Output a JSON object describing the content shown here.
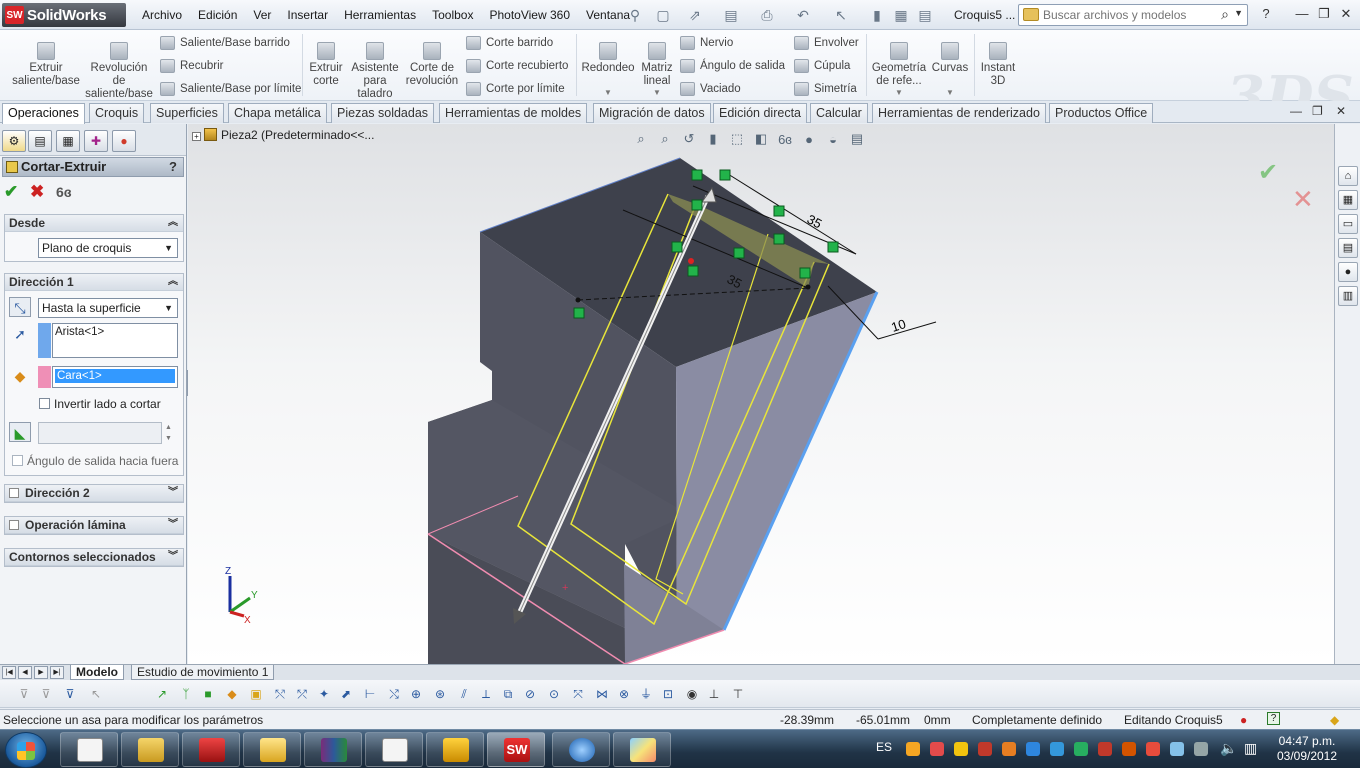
{
  "app": {
    "brand": "SolidWorks",
    "brand_badge": "SW",
    "document_title": "Croquis5 ...",
    "menu": [
      "Archivo",
      "Edición",
      "Ver",
      "Insertar",
      "Herramientas",
      "Toolbox",
      "PhotoView 360",
      "Ventana"
    ],
    "search_placeholder": "Buscar archivos y modelos",
    "help_label": "?"
  },
  "ribbon": {
    "large_buttons": [
      {
        "label1": "Extruir",
        "label2": "saliente/base",
        "label3": ""
      },
      {
        "label1": "Revolución",
        "label2": "de",
        "label3": "saliente/base"
      },
      {
        "label1": "Extruir",
        "label2": "corte",
        "label3": ""
      },
      {
        "label1": "Asistente",
        "label2": "para",
        "label3": "taladro"
      },
      {
        "label1": "Corte de",
        "label2": "revolución",
        "label3": ""
      },
      {
        "label1": "Redondeo",
        "label2": "",
        "label3": ""
      },
      {
        "label1": "Matriz",
        "label2": "lineal",
        "label3": ""
      },
      {
        "label1": "Geometría",
        "label2": "de refe...",
        "label3": ""
      },
      {
        "label1": "Curvas",
        "label2": "",
        "label3": ""
      },
      {
        "label1": "Instant",
        "label2": "3D",
        "label3": ""
      }
    ],
    "small_buttons": [
      "Saliente/Base barrido",
      "Recubrir",
      "Saliente/Base por límite",
      "Corte barrido",
      "Corte recubierto",
      "Corte por límite",
      "Nervio",
      "Ángulo de salida",
      "Vaciado",
      "Envolver",
      "Cúpula",
      "Simetría"
    ],
    "brand_mark": "3DS"
  },
  "tabs": [
    "Operaciones",
    "Croquis",
    "Superficies",
    "Chapa metálica",
    "Piezas soldadas",
    "Herramientas de moldes",
    "Migración de datos",
    "Edición directa",
    "Calcular",
    "Herramientas de renderizado",
    "Productos Office"
  ],
  "active_tab": "Operaciones",
  "property_manager": {
    "title": "Cortar-Extruir",
    "help": "?",
    "groups": {
      "desde": {
        "title": "Desde",
        "select_value": "Plano de croquis"
      },
      "direccion1": {
        "title": "Dirección 1",
        "select_value": "Hasta la superficie",
        "edge_item": "Arista<1>",
        "face_item": "Cara<1>",
        "flip_label": "Invertir lado a cortar",
        "draft_label": "Ángulo de salida hacia fuera"
      },
      "direccion2": {
        "title": "Dirección 2"
      },
      "lamina": {
        "title": "Operación lámina"
      },
      "contornos": {
        "title": "Contornos seleccionados"
      }
    }
  },
  "feature_tree": {
    "root_label": "Pieza2  (Predeterminado<<..."
  },
  "dimensions": [
    "35",
    "35",
    "10"
  ],
  "triad": {
    "z": "Z",
    "y": "Y",
    "x": "X"
  },
  "bottom_tabs": [
    "Modelo",
    "Estudio de movimiento 1"
  ],
  "status": {
    "message": "Seleccione un asa para modificar los parámetros",
    "x": "-28.39mm",
    "y": "-65.01mm",
    "z": "0mm",
    "state": "Completamente definido",
    "editing": "Editando Croquis5",
    "help": "?"
  },
  "taskbar": {
    "lang": "ES",
    "time": "04:47 p.m.",
    "date": "03/09/2012"
  },
  "colors": {
    "accent_blue": "#3a6ea5",
    "confirm_green": "#2a9a2a",
    "cancel_red": "#cc2222",
    "model_face": "#4d4f5a",
    "sketch_yellow": "#e8e53a",
    "edge_pink": "#f08cb0",
    "edge_blue": "#5aa0f0",
    "selection_blue": "#3399ff"
  }
}
